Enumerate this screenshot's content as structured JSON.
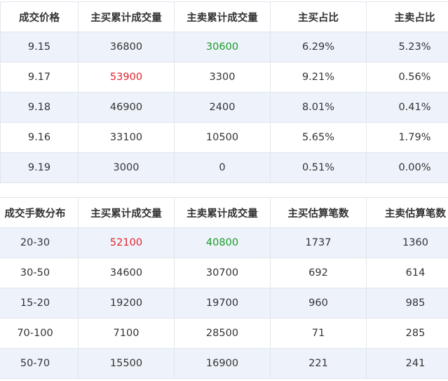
{
  "price_table": {
    "headers": [
      "成交价格",
      "主买累计成交量",
      "主卖累计成交量",
      "主买占比",
      "主卖占比"
    ],
    "rows": [
      {
        "price": "9.15",
        "buy_vol": "36800",
        "sell_vol": "30600",
        "buy_pct": "6.29%",
        "sell_pct": "5.23%"
      },
      {
        "price": "9.17",
        "buy_vol": "53900",
        "sell_vol": "3300",
        "buy_pct": "9.21%",
        "sell_pct": "0.56%"
      },
      {
        "price": "9.18",
        "buy_vol": "46900",
        "sell_vol": "2400",
        "buy_pct": "8.01%",
        "sell_pct": "0.41%"
      },
      {
        "price": "9.16",
        "buy_vol": "33100",
        "sell_vol": "10500",
        "buy_pct": "5.65%",
        "sell_pct": "1.79%"
      },
      {
        "price": "9.19",
        "buy_vol": "3000",
        "sell_vol": "0",
        "buy_pct": "0.51%",
        "sell_pct": "0.00%"
      }
    ]
  },
  "volume_table": {
    "headers": [
      "成交手数分布",
      "主买累计成交量",
      "主卖累计成交量",
      "主买估算笔数",
      "主卖估算笔数"
    ],
    "rows": [
      {
        "range": "20-30",
        "buy_vol": "52100",
        "sell_vol": "40800",
        "buy_cnt": "1737",
        "sell_cnt": "1360"
      },
      {
        "range": "30-50",
        "buy_vol": "34600",
        "sell_vol": "30700",
        "buy_cnt": "692",
        "sell_cnt": "614"
      },
      {
        "range": "15-20",
        "buy_vol": "19200",
        "sell_vol": "19700",
        "buy_cnt": "960",
        "sell_cnt": "985"
      },
      {
        "range": "70-100",
        "buy_vol": "7100",
        "sell_vol": "28500",
        "buy_cnt": "71",
        "sell_cnt": "285"
      },
      {
        "range": "50-70",
        "buy_vol": "15500",
        "sell_vol": "16900",
        "buy_cnt": "221",
        "sell_cnt": "241"
      }
    ]
  },
  "colors": {
    "highlight_red": "#e0252b",
    "highlight_green": "#1a9a27",
    "row_stripe": "#eef3fb",
    "border": "#e1e6ee"
  }
}
